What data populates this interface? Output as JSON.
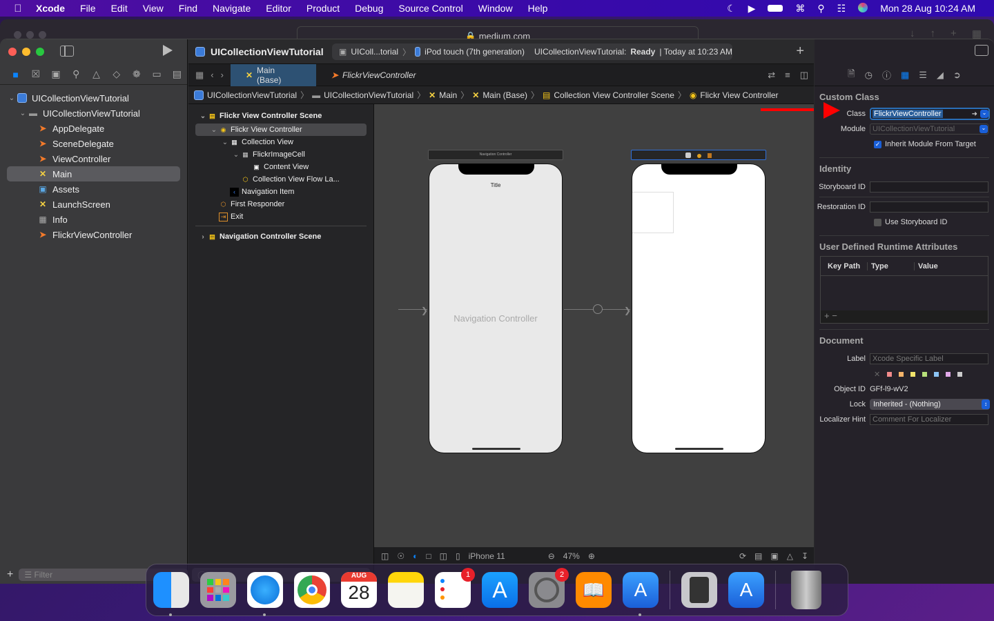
{
  "menubar": {
    "app": "Xcode",
    "items": [
      "File",
      "Edit",
      "View",
      "Find",
      "Navigate",
      "Editor",
      "Product",
      "Debug",
      "Source Control",
      "Window",
      "Help"
    ],
    "clock": "Mon 28 Aug  10:24 AM"
  },
  "browser": {
    "url": "medium.com"
  },
  "navigator": {
    "tabs": [
      "folder-icon",
      "source-control-icon",
      "symbol-icon",
      "search-icon",
      "issue-icon",
      "test-icon",
      "debug-icon",
      "breakpoint-icon",
      "report-icon"
    ],
    "tree": [
      {
        "label": "UICollectionViewTutorial",
        "type": "project",
        "level": 0
      },
      {
        "label": "UICollectionViewTutorial",
        "type": "folder",
        "level": 1
      },
      {
        "label": "AppDelegate",
        "type": "swift",
        "level": 2
      },
      {
        "label": "SceneDelegate",
        "type": "swift",
        "level": 2
      },
      {
        "label": "ViewController",
        "type": "swift",
        "level": 2
      },
      {
        "label": "Main",
        "type": "storyboard",
        "level": 2,
        "selected": true
      },
      {
        "label": "Assets",
        "type": "assets",
        "level": 2
      },
      {
        "label": "LaunchScreen",
        "type": "storyboard",
        "level": 2
      },
      {
        "label": "Info",
        "type": "plist",
        "level": 2
      },
      {
        "label": "FlickrViewController",
        "type": "swift",
        "level": 2
      }
    ],
    "filter_placeholder": "Filter"
  },
  "toolbar": {
    "project_title": "UICollectionViewTutorial",
    "scheme": "UIColl...torial",
    "device": "iPod touch (7th generation)",
    "status_prefix": "UICollectionViewTutorial: ",
    "status": "Ready",
    "status_time": "| Today at 10:23 AM"
  },
  "tabs": [
    {
      "label": "Main (Base)",
      "active": true
    },
    {
      "label": "FlickrViewController",
      "active": false
    }
  ],
  "jumpbar": [
    "UICollectionViewTutorial",
    "UICollectionViewTutorial",
    "Main",
    "Main (Base)",
    "Collection View Controller Scene",
    "Flickr View Controller"
  ],
  "outline": {
    "rows": [
      {
        "label": "Flickr View Controller Scene",
        "level": 0,
        "scene": true,
        "chev": "v"
      },
      {
        "label": "Flickr View Controller",
        "level": 1,
        "selected": true,
        "chev": "v"
      },
      {
        "label": "Collection View",
        "level": 2,
        "chev": "v"
      },
      {
        "label": "FlickrImageCell",
        "level": 3,
        "chev": "v"
      },
      {
        "label": "Content View",
        "level": 4,
        "chev": ""
      },
      {
        "label": "Collection View Flow La...",
        "level": 3,
        "chev": ""
      },
      {
        "label": "Navigation Item",
        "level": 2,
        "chev": ""
      },
      {
        "label": "First Responder",
        "level": 1,
        "chev": ""
      },
      {
        "label": "Exit",
        "level": 1,
        "chev": ""
      },
      {
        "label": "Navigation Controller Scene",
        "level": 0,
        "scene": true,
        "chev": ">"
      }
    ],
    "filter_placeholder": "Filter"
  },
  "canvas": {
    "nav_scene_title": "Navigation Controller",
    "nav_title": "Title",
    "nav_body": "Navigation Controller",
    "device": "iPhone 11",
    "zoom": "47%"
  },
  "inspector": {
    "custom_class_header": "Custom Class",
    "class_label": "Class",
    "class_value": "FlickrViewController",
    "module_label": "Module",
    "module_placeholder": "UICollectionViewTutorial",
    "inherit_label": "Inherit Module From Target",
    "inherit_checked": true,
    "identity_header": "Identity",
    "storyboard_id_label": "Storyboard ID",
    "restoration_id_label": "Restoration ID",
    "use_storyboard_id_label": "Use Storyboard ID",
    "udra_header": "User Defined Runtime Attributes",
    "udra_columns": [
      "Key Path",
      "Type",
      "Value"
    ],
    "document_header": "Document",
    "label_label": "Label",
    "label_placeholder": "Xcode Specific Label",
    "label_colors": [
      "#f28b8b",
      "#f5b46a",
      "#f2e36b",
      "#b7e07a",
      "#8cc4f5",
      "#e0a8e8",
      "#cccccc"
    ],
    "object_id_label": "Object ID",
    "object_id": "GFf-l9-wV2",
    "lock_label": "Lock",
    "lock_value": "Inherited - (Nothing)",
    "localizer_label": "Localizer Hint",
    "localizer_placeholder": "Comment For Localizer"
  },
  "dock": {
    "apps": [
      {
        "name": "Finder",
        "running": true
      },
      {
        "name": "Launchpad"
      },
      {
        "name": "Safari",
        "running": true
      },
      {
        "name": "Chrome"
      },
      {
        "name": "Calendar",
        "month": "AUG",
        "day": "28"
      },
      {
        "name": "Notes"
      },
      {
        "name": "Reminders",
        "badge": "1"
      },
      {
        "name": "App Store"
      },
      {
        "name": "System Preferences",
        "badge": "2"
      },
      {
        "name": "Books"
      },
      {
        "name": "Xcode",
        "running": true
      },
      {
        "name": "Calculator"
      },
      {
        "name": "Simulator"
      },
      {
        "name": "Trash"
      }
    ]
  }
}
